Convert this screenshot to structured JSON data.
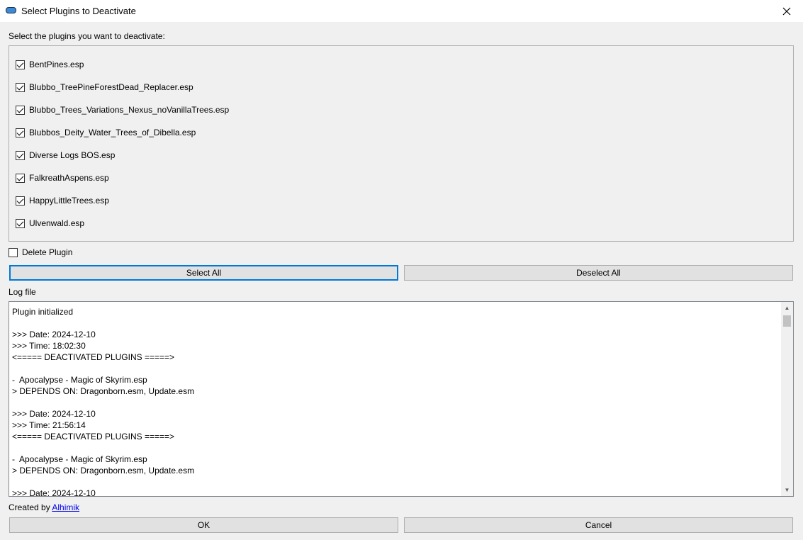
{
  "window": {
    "title": "Select Plugins to Deactivate"
  },
  "prompt": "Select the plugins you want to deactivate:",
  "plugins": [
    {
      "name": "BentPines.esp",
      "checked": true
    },
    {
      "name": "Blubbo_TreePineForestDead_Replacer.esp",
      "checked": true
    },
    {
      "name": "Blubbo_Trees_Variations_Nexus_noVanillaTrees.esp",
      "checked": true
    },
    {
      "name": "Blubbos_Deity_Water_Trees_of_Dibella.esp",
      "checked": true
    },
    {
      "name": "Diverse Logs BOS.esp",
      "checked": true
    },
    {
      "name": "FalkreathAspens.esp",
      "checked": true
    },
    {
      "name": "HappyLittleTrees.esp",
      "checked": true
    },
    {
      "name": "Ulvenwald.esp",
      "checked": true
    }
  ],
  "delete_plugin": {
    "label": "Delete Plugin",
    "checked": false
  },
  "buttons": {
    "select_all": "Select All",
    "deselect_all": "Deselect All",
    "ok": "OK",
    "cancel": "Cancel"
  },
  "log": {
    "label": "Log file",
    "lines": [
      "Plugin initialized",
      "",
      ">>> Date: 2024-12-10",
      ">>> Time: 18:02:30",
      "<===== DEACTIVATED PLUGINS =====>",
      "",
      "-  Apocalypse - Magic of Skyrim.esp",
      "> DEPENDS ON: Dragonborn.esm, Update.esm",
      "",
      ">>> Date: 2024-12-10",
      ">>> Time: 21:56:14",
      "<===== DEACTIVATED PLUGINS =====>",
      "",
      "-  Apocalypse - Magic of Skyrim.esp",
      "> DEPENDS ON: Dragonborn.esm, Update.esm",
      "",
      ">>> Date: 2024-12-10"
    ]
  },
  "credit": {
    "prefix": "Created by ",
    "author": "Alhimik"
  }
}
